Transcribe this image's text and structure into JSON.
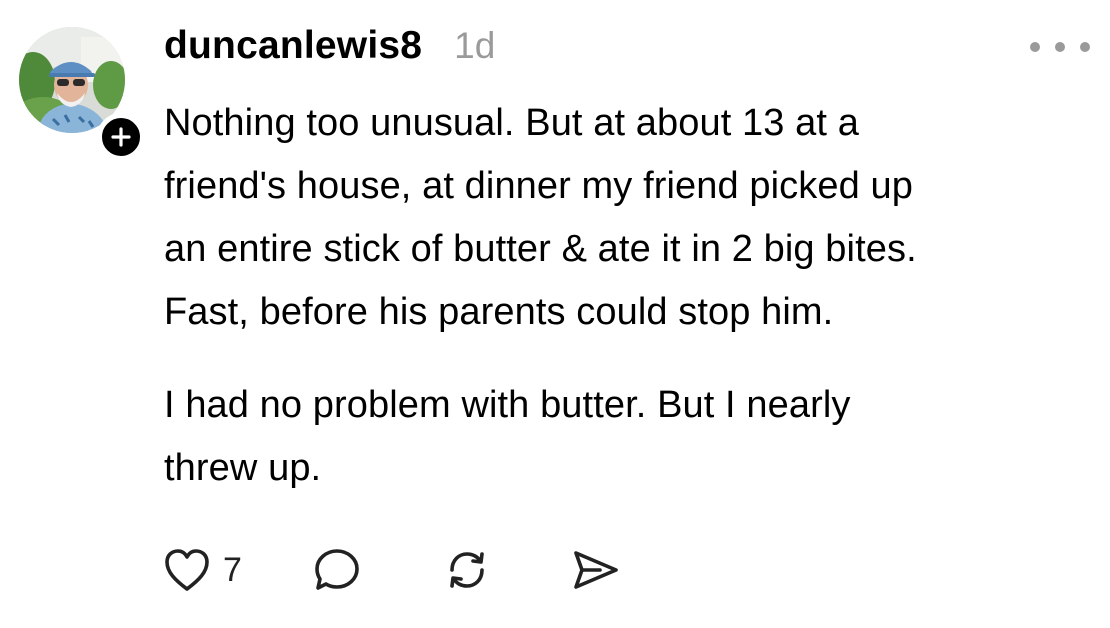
{
  "post": {
    "username": "duncanlewis8",
    "timestamp": "1d",
    "paragraphs": [
      "Nothing too unusual. But at about 13 at a\nfriend's house, at dinner my friend picked up\nan entire stick of butter & ate it in 2 big bites.\nFast, before his parents could stop him.",
      "I had no problem with butter. But I nearly\nthrew up."
    ],
    "like_count": "7"
  },
  "icons": {
    "avatar": "avatar",
    "follow": "plus-icon",
    "more": "more-dots-icon",
    "like": "heart-icon",
    "reply": "comment-icon",
    "repost": "repost-icon",
    "share": "send-icon"
  },
  "colors": {
    "text": "#000000",
    "muted": "#9a9a9a",
    "background": "#ffffff"
  }
}
